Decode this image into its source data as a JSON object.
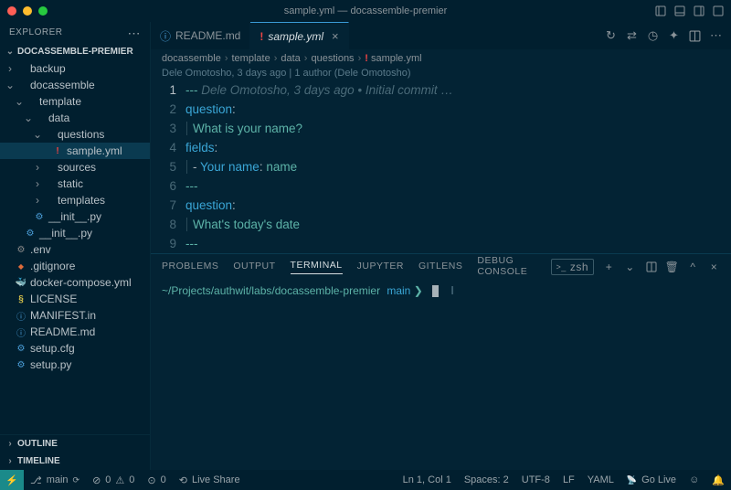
{
  "window": {
    "title": "sample.yml — docassemble-premier"
  },
  "sidebar": {
    "header": "EXPLORER",
    "project": "DOCASSEMBLE-PREMIER",
    "tree": [
      {
        "d": 0,
        "k": "folder",
        "open": false,
        "label": "backup"
      },
      {
        "d": 0,
        "k": "folder",
        "open": true,
        "label": "docassemble"
      },
      {
        "d": 1,
        "k": "folder",
        "open": true,
        "label": "template"
      },
      {
        "d": 2,
        "k": "folder",
        "open": true,
        "label": "data"
      },
      {
        "d": 3,
        "k": "folder",
        "open": true,
        "label": "questions"
      },
      {
        "d": 4,
        "k": "yml",
        "leaf": true,
        "sel": true,
        "label": "sample.yml"
      },
      {
        "d": 3,
        "k": "folder",
        "open": false,
        "label": "sources"
      },
      {
        "d": 3,
        "k": "folder",
        "open": false,
        "label": "static"
      },
      {
        "d": 3,
        "k": "folder",
        "open": false,
        "label": "templates"
      },
      {
        "d": 2,
        "k": "py",
        "leaf": true,
        "label": "__init__.py"
      },
      {
        "d": 1,
        "k": "py",
        "leaf": true,
        "label": "__init__.py"
      },
      {
        "d": 0,
        "k": "env",
        "leaf": true,
        "label": ".env"
      },
      {
        "d": 0,
        "k": "git",
        "leaf": true,
        "label": ".gitignore"
      },
      {
        "d": 0,
        "k": "docker",
        "leaf": true,
        "label": "docker-compose.yml"
      },
      {
        "d": 0,
        "k": "lic",
        "leaf": true,
        "label": "LICENSE"
      },
      {
        "d": 0,
        "k": "info",
        "leaf": true,
        "label": "MANIFEST.in"
      },
      {
        "d": 0,
        "k": "info",
        "leaf": true,
        "label": "README.md"
      },
      {
        "d": 0,
        "k": "cfg",
        "leaf": true,
        "label": "setup.cfg"
      },
      {
        "d": 0,
        "k": "py",
        "leaf": true,
        "label": "setup.py"
      }
    ],
    "outline": "OUTLINE",
    "timeline": "TIMELINE"
  },
  "tabs": [
    {
      "icon": "info",
      "label": "README.md",
      "active": false
    },
    {
      "icon": "yml",
      "label": "sample.yml",
      "active": true,
      "modified": false
    }
  ],
  "breadcrumb": [
    "docassemble",
    "template",
    "data",
    "questions",
    "sample.yml"
  ],
  "authorline": "Dele Omotosho, 3 days ago | 1 author (Dele Omotosho)",
  "code": {
    "inline_blame": "Dele Omotosho, 3 days ago • Initial commit …",
    "lines": [
      {
        "t": "---"
      },
      {
        "t": "question:",
        "cls": "key"
      },
      {
        "t": "What is your name?",
        "cls": "str",
        "indent": true
      },
      {
        "t": "fields:",
        "cls": "key"
      },
      {
        "t": "- Your name: name",
        "cls": "mixed",
        "indent": true
      },
      {
        "t": "---"
      },
      {
        "t": "question:",
        "cls": "key"
      },
      {
        "t": "What's today's date",
        "cls": "str",
        "indent": true
      },
      {
        "t": "---"
      }
    ]
  },
  "panel": {
    "tabs": [
      "PROBLEMS",
      "OUTPUT",
      "TERMINAL",
      "JUPYTER",
      "GITLENS",
      "DEBUG CONSOLE"
    ],
    "active": 2,
    "shell": "zsh",
    "prompt_path": "~/Projects/authwit/labs/docassemble-premier",
    "prompt_branch": "main",
    "prompt_symbol": "❯"
  },
  "status": {
    "branch": "main",
    "sync": "",
    "errors": "0",
    "warnings": "0",
    "port": "0",
    "liveshare": "Live Share",
    "pos": "Ln 1, Col 1",
    "spaces": "Spaces: 2",
    "enc": "UTF-8",
    "eol": "LF",
    "lang": "YAML",
    "golive": "Go Live"
  }
}
